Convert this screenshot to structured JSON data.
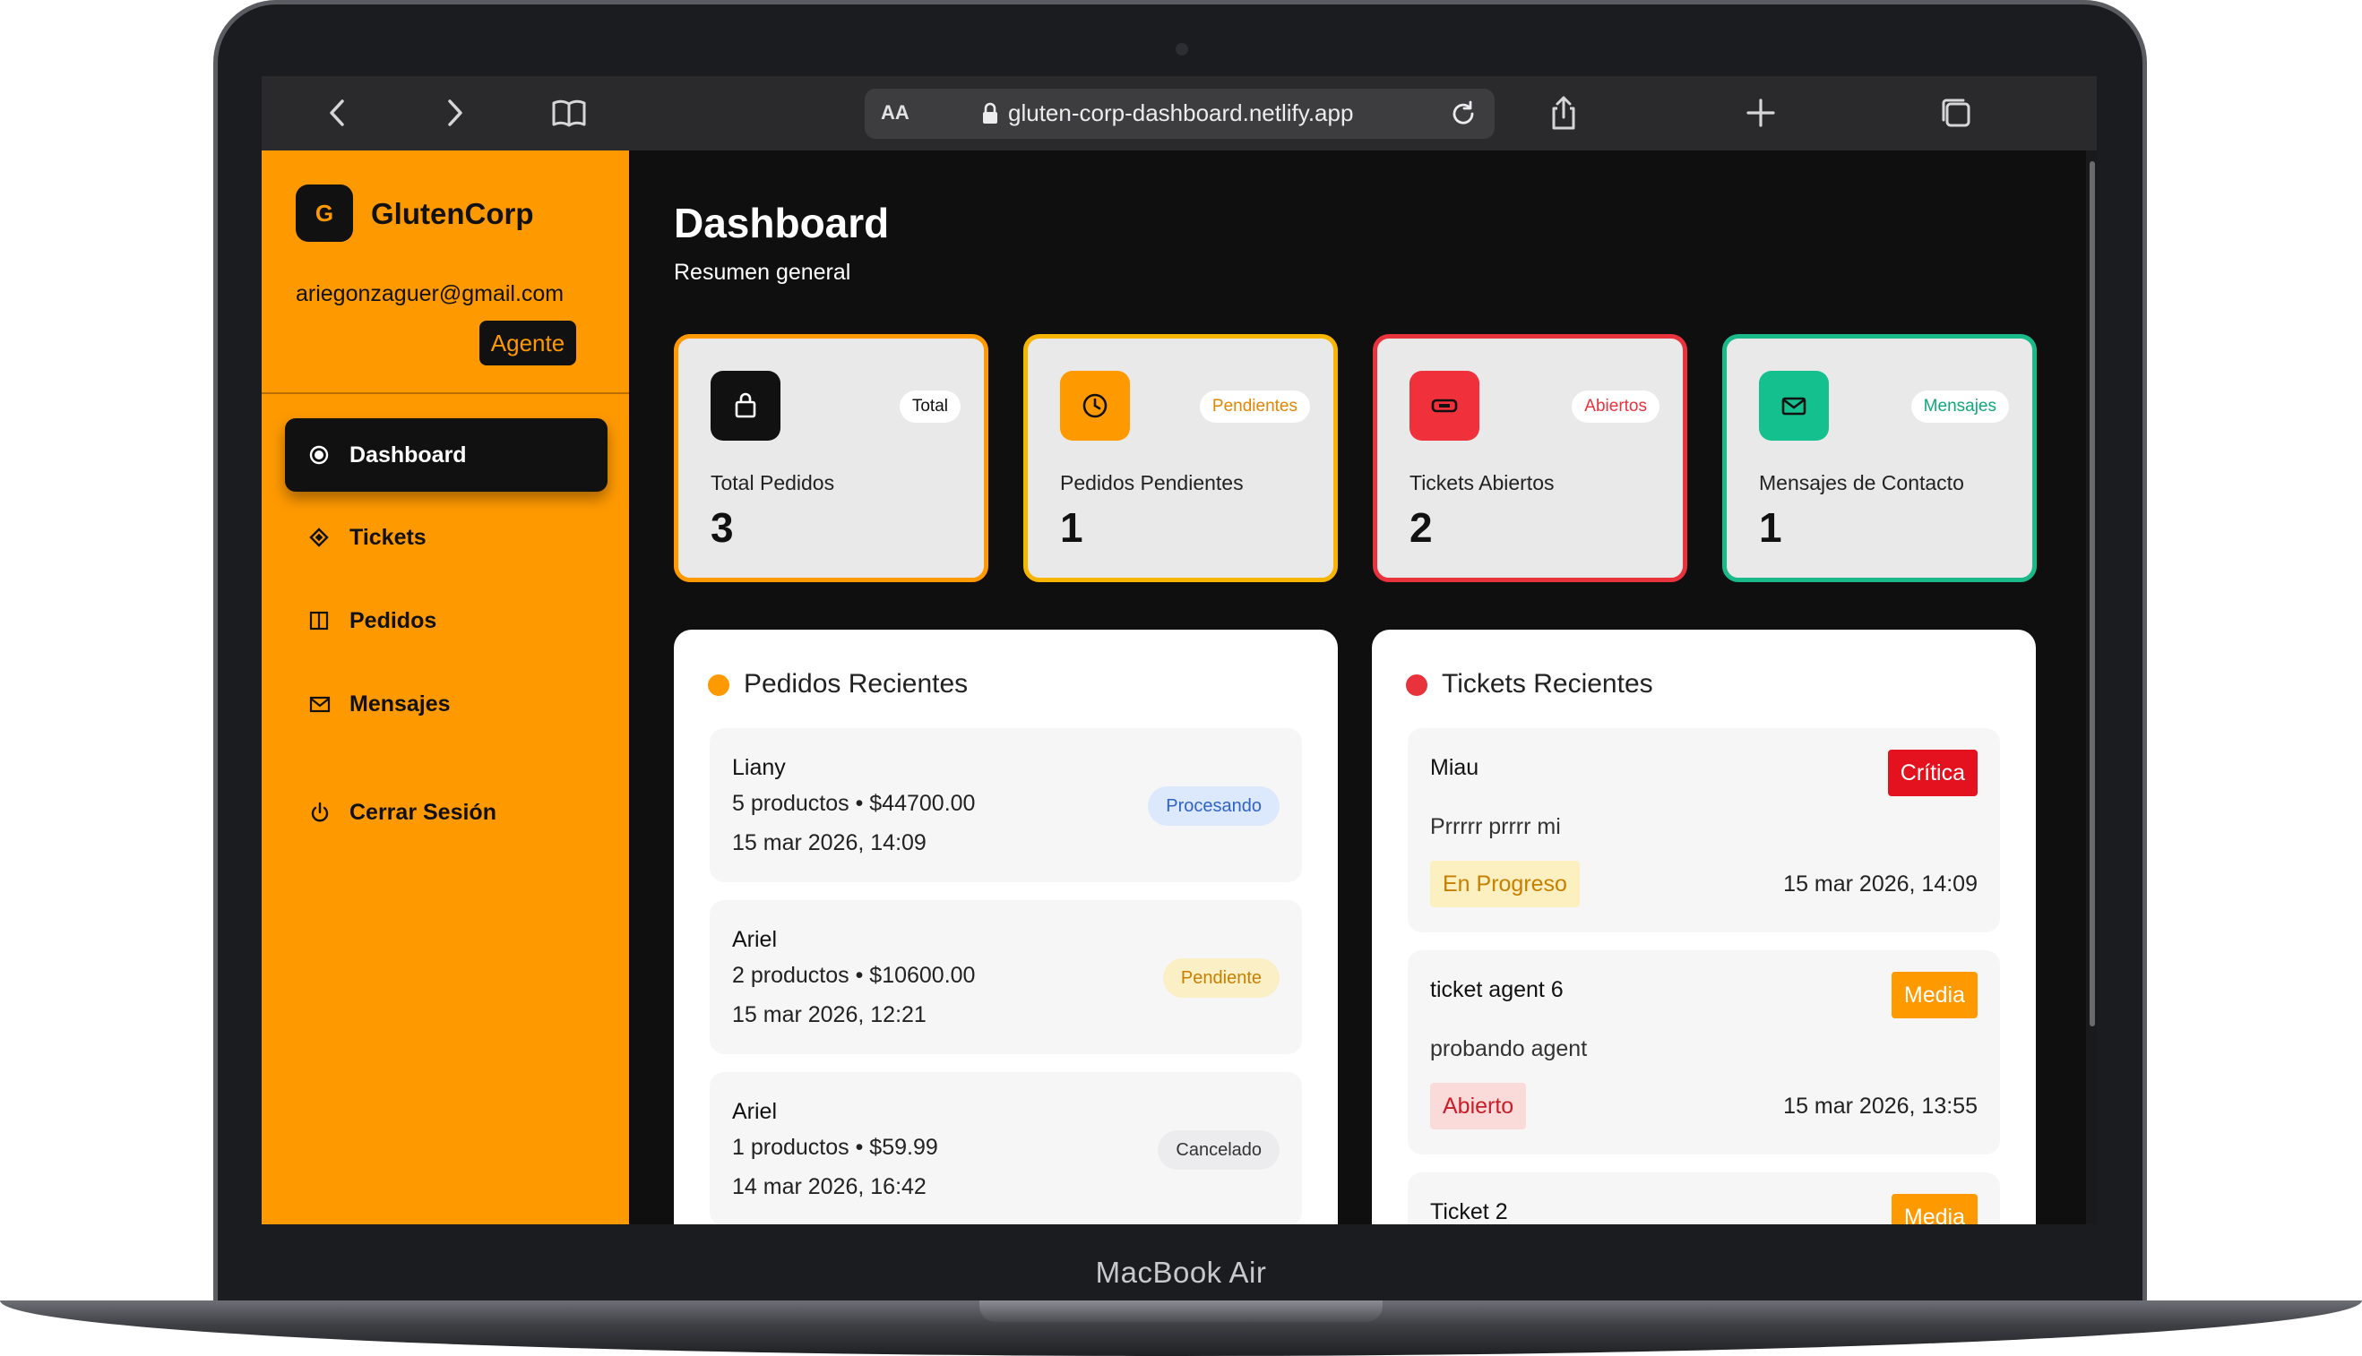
{
  "device": {
    "label": "MacBook Air"
  },
  "browser": {
    "url": "gluten-corp-dashboard.netlify.app",
    "reader_label": "AA"
  },
  "sidebar": {
    "logo_letter": "G",
    "brand": "GlutenCorp",
    "email": "ariegonzaguer@gmail.com",
    "role": "Agente",
    "items": [
      {
        "label": "Dashboard",
        "icon": "dot-circle-icon",
        "active": true
      },
      {
        "label": "Tickets",
        "icon": "diamond-icon",
        "active": false
      },
      {
        "label": "Pedidos",
        "icon": "book-icon",
        "active": false
      },
      {
        "label": "Mensajes",
        "icon": "mail-icon",
        "active": false
      }
    ],
    "logout": {
      "label": "Cerrar Sesión",
      "icon": "power-icon"
    }
  },
  "header": {
    "title": "Dashboard",
    "subtitle": "Resumen general"
  },
  "stats": [
    {
      "label": "Total Pedidos",
      "value": "3",
      "badge": "Total",
      "color": "#ff9900",
      "icon_bg": "#111111",
      "badge_color": "#111111",
      "icon": "bag-icon"
    },
    {
      "label": "Pedidos Pendientes",
      "value": "1",
      "badge": "Pendientes",
      "color": "#f7b500",
      "icon_bg": "#ff9900",
      "badge_color": "#e08600",
      "icon": "clock-icon"
    },
    {
      "label": "Tickets Abiertos",
      "value": "2",
      "badge": "Abiertos",
      "color": "#e8323c",
      "icon_bg": "#f0303a",
      "badge_color": "#e8323c",
      "icon": "ticket-icon"
    },
    {
      "label": "Mensajes de Contacto",
      "value": "1",
      "badge": "Mensajes",
      "color": "#19b98a",
      "icon_bg": "#14c08e",
      "badge_color": "#11a87a",
      "icon": "envelope-icon"
    }
  ],
  "recent_orders": {
    "title": "Pedidos Recientes",
    "dot_color": "#ff9900",
    "items": [
      {
        "name": "Liany",
        "summary": "5 productos • $44700.00",
        "date": "15 mar 2026, 14:09",
        "status": "Procesando",
        "status_bg": "#dce8fb",
        "status_fg": "#2f63c8"
      },
      {
        "name": "Ariel",
        "summary": "2 productos • $10600.00",
        "date": "15 mar 2026, 12:21",
        "status": "Pendiente",
        "status_bg": "#fbefc6",
        "status_fg": "#c77f00"
      },
      {
        "name": "Ariel",
        "summary": "1 productos • $59.99",
        "date": "14 mar 2026, 16:42",
        "status": "Cancelado",
        "status_bg": "#ececee",
        "status_fg": "#333333"
      }
    ]
  },
  "recent_tickets": {
    "title": "Tickets Recientes",
    "dot_color": "#e8323c",
    "items": [
      {
        "title": "Miau",
        "description": "Prrrrr prrrr mi",
        "priority": "Crítica",
        "priority_bg": "#e4121e",
        "status": "En Progreso",
        "status_bg": "#fcefc0",
        "status_fg": "#c77f00",
        "date": "15 mar 2026, 14:09"
      },
      {
        "title": "ticket agent 6",
        "description": "probando agent",
        "priority": "Media",
        "priority_bg": "#ff9900",
        "status": "Abierto",
        "status_bg": "#fbdada",
        "status_fg": "#c81e28",
        "date": "15 mar 2026, 13:55"
      },
      {
        "title": "Ticket 2",
        "description": "",
        "priority": "Media",
        "priority_bg": "#ff9900",
        "status": "",
        "status_bg": "#fbdada",
        "status_fg": "#c81e28",
        "date": ""
      }
    ]
  }
}
